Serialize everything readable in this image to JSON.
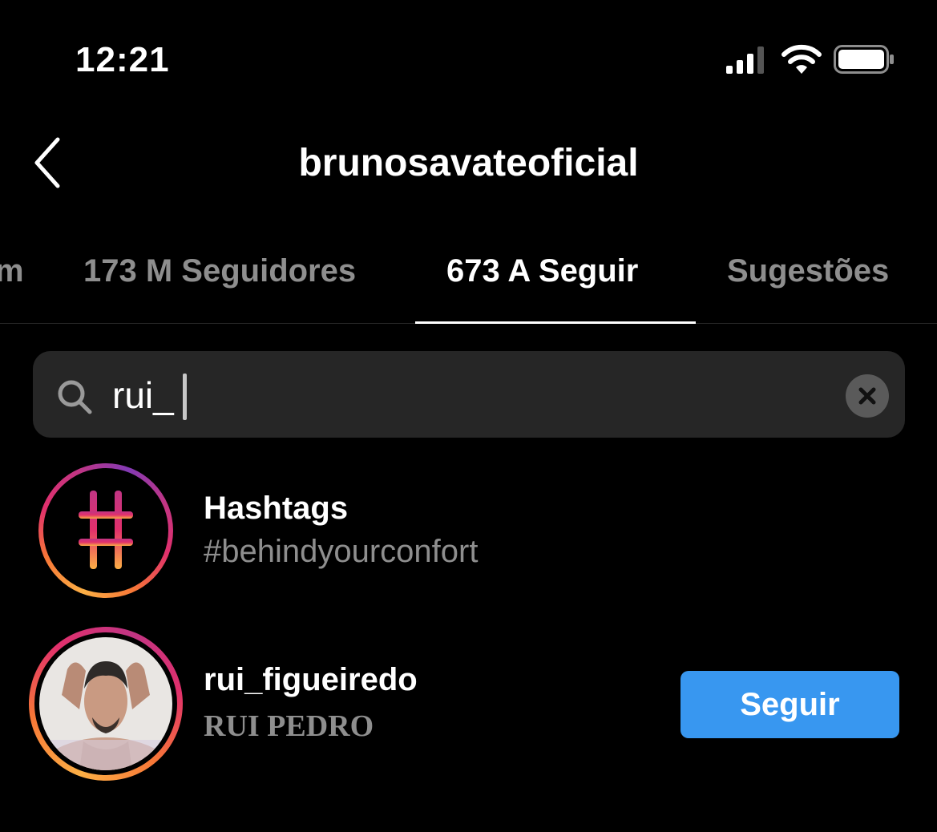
{
  "status_bar": {
    "time": "12:21"
  },
  "header": {
    "title": "brunosavateoficial"
  },
  "tabs": [
    {
      "label": "m"
    },
    {
      "label": "173 M Seguidores"
    },
    {
      "label": "673 A Seguir",
      "active": true
    },
    {
      "label": "Sugestões"
    }
  ],
  "search": {
    "value": "rui_"
  },
  "results": [
    {
      "title": "Hashtags",
      "subtitle": "#behindyourconfort"
    },
    {
      "title": "rui_figueiredo",
      "subtitle": "RUI PEDRO",
      "button": "Seguir"
    }
  ],
  "colors": {
    "background": "#000000",
    "follow_button": "#3897f0",
    "secondary_text": "#8e8e8e",
    "search_background": "#262626"
  },
  "icons": [
    "signal-icon",
    "wifi-icon",
    "battery-icon",
    "back-chevron-icon",
    "search-icon",
    "clear-icon",
    "hashtag-icon"
  ]
}
